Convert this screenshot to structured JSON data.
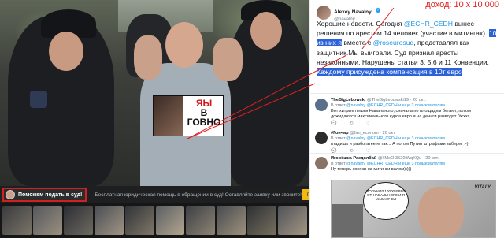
{
  "overlay": {
    "income_label": "доход: 10 х 10 000"
  },
  "poster": {
    "line1": "ЯЫ",
    "line2": "В",
    "line3": "ГОВНО"
  },
  "ad": {
    "title": "Поможем подать в суд!",
    "description": "Бесплатная юридическая помощь в обращении в суд! Оставляйте заявку или звоните!",
    "button": "Перейти"
  },
  "tweet": {
    "name": "Alexey Navalny",
    "handle": "@navalny",
    "text_a": "Хорошие новости. Сегодня ",
    "mention_echr": "@ECHR_CEDH",
    "text_b": " вынес решения по арестам 14 человек (участие в митингах). ",
    "hl_1": "10 из них я",
    "text_c": " вместе с ",
    "mention_rose": "@roseurosud",
    "text_d": ", представлял как защитник.Мы выиграли. Суд признал аресты незаконными. Нарушены статьи 3, 5,6 и 11 Конвенции. ",
    "hl_2": "Каждому присуждена компенсация в 10т евро"
  },
  "replies": [
    {
      "name": "TheBigLebowski",
      "handle": "@TheBigLebowski19",
      "time": "20 окт.",
      "meta_prefix": "В ответ ",
      "meta_mentions": "@navalny @ECHR_CEDH",
      "meta_suffix": " и еще 3 пользователям",
      "text_1": "Вот хитрые пешки Навального, сначала по площадям бегают, потом",
      "text_2": "дожидаются максимального курса евро и на деньги разводят. Ухххх",
      "avatar_color": "#5a6f8a",
      "actions": [
        "💬",
        "⟲",
        "♡"
      ]
    },
    {
      "name": "#Гончар",
      "handle": "@fan_econom",
      "time": "20 окт.",
      "meta_prefix": "В ответ ",
      "meta_mentions": "@navalny @ECHR_CEDH",
      "meta_suffix": " и еще 3 пользователям",
      "text_1": "гладишь и разбогатеете так... А потом Путин штрафами заберет :-)",
      "text_2": "",
      "avatar_color": "#2c2c2c",
      "actions": [
        "💬",
        "⟲",
        "♡"
      ]
    },
    {
      "name": "Игорёшка Раздолбай",
      "handle": "@lIMeOI3520lWqXQu",
      "time": "20 окт.",
      "meta_prefix": "В ответ ",
      "meta_mentions": "@navalny @ECHR_CEDH",
      "meta_suffix": " и еще 3 пользователям",
      "text_1": "Ну теперь коняки на митинги валом)))))",
      "text_2": "",
      "avatar_color": "#8a7266",
      "actions": []
    }
  ],
  "meme": {
    "bubble": "ПОЛУЧИЛ 10000 ЕВРО ОТ НАВАЛЬНОГО И Я МАКАЮЧЕЛ",
    "tag": "VITALY"
  },
  "colors": {
    "accent": "#1da1f2",
    "highlight": "#2b62d8",
    "alert_red": "#e02020",
    "ad_button": "#f2b90f"
  }
}
